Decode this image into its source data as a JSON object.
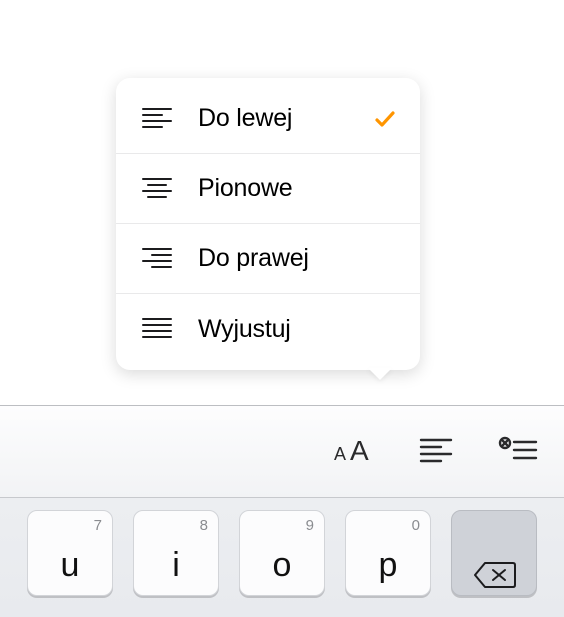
{
  "colors": {
    "accent": "#ff9500"
  },
  "menu": {
    "items": [
      {
        "label": "Do lewej",
        "icon": "align-left",
        "selected": true
      },
      {
        "label": "Pionowe",
        "icon": "align-center",
        "selected": false
      },
      {
        "label": "Do prawej",
        "icon": "align-right",
        "selected": false
      },
      {
        "label": "Wyjustuj",
        "icon": "align-justify",
        "selected": false
      }
    ]
  },
  "toolbar": {
    "buttons": [
      {
        "name": "text-size",
        "icon": "text-size-icon"
      },
      {
        "name": "alignment",
        "icon": "align-left-icon"
      },
      {
        "name": "list-indent",
        "icon": "list-indent-icon"
      }
    ]
  },
  "keyboard": {
    "keys": [
      {
        "main": "u",
        "alt": "7"
      },
      {
        "main": "i",
        "alt": "8"
      },
      {
        "main": "o",
        "alt": "9"
      },
      {
        "main": "p",
        "alt": "0"
      },
      {
        "main": "",
        "alt": "",
        "special": "backspace"
      }
    ]
  }
}
